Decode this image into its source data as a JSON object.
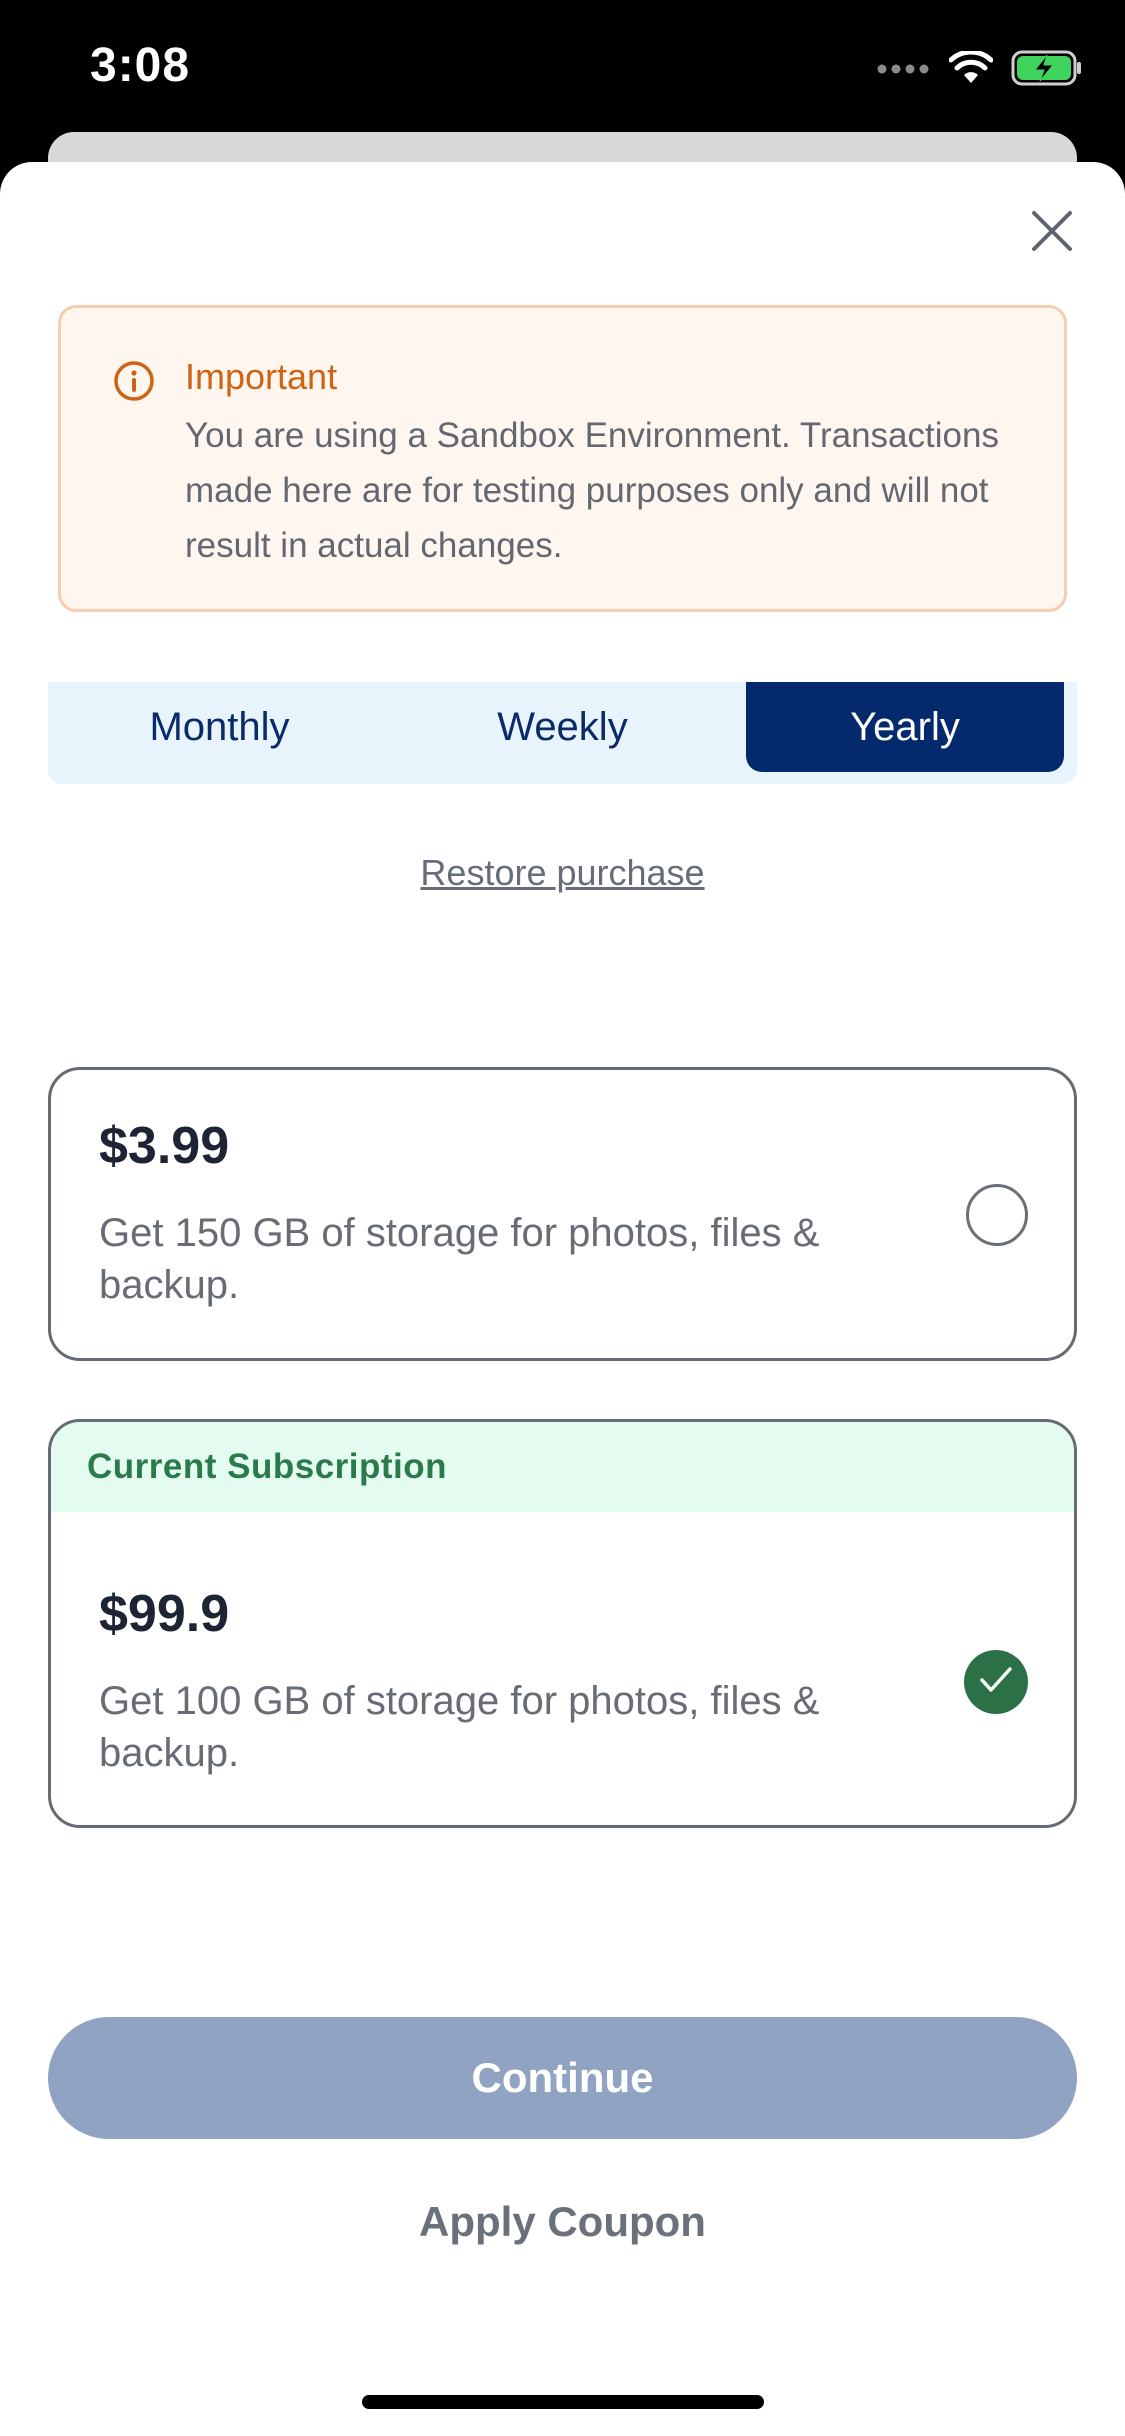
{
  "status_bar": {
    "time": "3:08",
    "icons": [
      "signal-dots-icon",
      "wifi-icon",
      "battery-charging-icon"
    ]
  },
  "alert": {
    "icon": "info-icon",
    "title": "Important",
    "body": "You are using a Sandbox Environment. Transactions made here are for testing purposes only and will not result in actual changes."
  },
  "period_tabs": {
    "items": [
      {
        "label": "Monthly",
        "selected": false
      },
      {
        "label": "Weekly",
        "selected": false
      },
      {
        "label": "Yearly",
        "selected": true
      }
    ]
  },
  "restore_label": "Restore purchase",
  "plans": [
    {
      "price": "$3.99",
      "description": "Get 150 GB of storage for photos, files & backup.",
      "selected": false,
      "current": false
    },
    {
      "banner": "Current Subscription",
      "price": "$99.9",
      "description": "Get 100 GB of storage for photos, files & backup.",
      "selected": true,
      "current": true
    }
  ],
  "continue_label": "Continue",
  "coupon_label": "Apply Coupon",
  "colors": {
    "primary": "#042a6d",
    "alert_accent": "#cf6314",
    "success": "#2c7047",
    "button_disabled": "#91a3c2"
  }
}
